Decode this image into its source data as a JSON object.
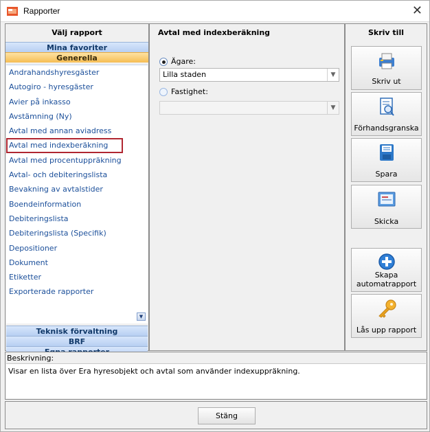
{
  "window": {
    "title": "Rapporter",
    "close_glyph": "✕"
  },
  "left_panel": {
    "header": "Välj rapport",
    "categories_top": [
      "Mina favoriter",
      "Generella"
    ],
    "items": [
      "Andrahandshyresgäster",
      "Autogiro - hyresgäster",
      "Avier på inkasso",
      "Avstämning (Ny)",
      "Avtal med annan aviadress",
      "Avtal med indexberäkning",
      "Avtal med procentuppräkning",
      "Avtal- och debiteringslista",
      "Bevakning av avtalstider",
      "Boendeinformation",
      "Debiteringslista",
      "Debiteringslista (Specifik)",
      "Depositioner",
      "Dokument",
      "Etiketter",
      "Exporterade rapporter"
    ],
    "selected_index": 5,
    "categories_bottom": [
      "Teknisk förvaltning",
      "BRF",
      "Egna rapporter"
    ]
  },
  "middle_panel": {
    "header": "Avtal med indexberäkning",
    "owner_label": "Ägare:",
    "owner_value": "Lilla staden",
    "property_label": "Fastighet:",
    "property_value": ""
  },
  "right_panel": {
    "header": "Skriv till",
    "buttons": [
      {
        "label": "Skriv ut",
        "icon": "printer-icon"
      },
      {
        "label": "Förhandsgranska",
        "icon": "preview-icon"
      },
      {
        "label": "Spara",
        "icon": "save-icon"
      },
      {
        "label": "Skicka",
        "icon": "email-icon"
      },
      {
        "label": "Skapa automatrapport",
        "icon": "add-icon"
      },
      {
        "label": "Lås upp rapport",
        "icon": "key-icon"
      }
    ]
  },
  "description": {
    "label": "Beskrivning:",
    "text": "Visar en lista över Era hyresobjekt och avtal som använder indexuppräkning."
  },
  "footer": {
    "close_label": "Stäng"
  }
}
